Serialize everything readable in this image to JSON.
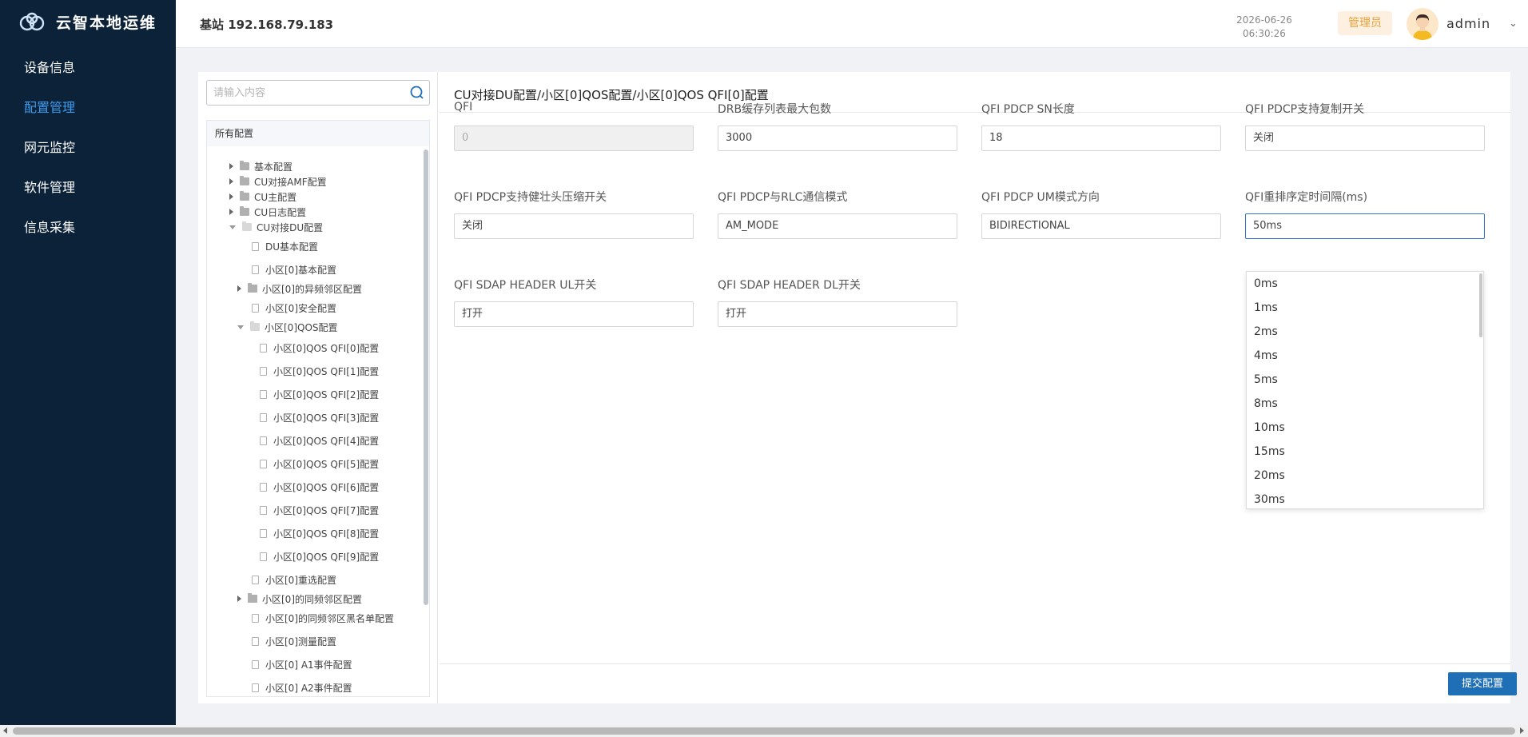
{
  "app": {
    "logo_text": "云智本地运维",
    "logo_icon": "cloud-logo-icon"
  },
  "sidebar": {
    "items": [
      {
        "label": "设备信息",
        "active": false
      },
      {
        "label": "配置管理",
        "active": true
      },
      {
        "label": "网元监控",
        "active": false
      },
      {
        "label": "软件管理",
        "active": false
      },
      {
        "label": "信息采集",
        "active": false
      }
    ],
    "active_color": "#3c9cf0",
    "bg_color": "#0c2238"
  },
  "header": {
    "station": "基站 192.168.79.183",
    "date": "2026-06-26",
    "time": "06:30:26",
    "role": "管理员",
    "username": "admin"
  },
  "tree": {
    "search_placeholder": "请输入内容",
    "root": "所有配置",
    "nodes": [
      {
        "label": "基本配置",
        "type": "folder",
        "expanded": false
      },
      {
        "label": "CU对接AMF配置",
        "type": "folder",
        "expanded": false
      },
      {
        "label": "CU主配置",
        "type": "folder",
        "expanded": false
      },
      {
        "label": "CU日志配置",
        "type": "folder",
        "expanded": false
      },
      {
        "label": "CU对接DU配置",
        "type": "folder",
        "expanded": true
      },
      {
        "label": "DU基本配置",
        "type": "file"
      },
      {
        "label": "小区[0]基本配置",
        "type": "file"
      },
      {
        "label": "小区[0]的异频邻区配置",
        "type": "folder",
        "expanded": false
      },
      {
        "label": "小区[0]安全配置",
        "type": "file"
      },
      {
        "label": "小区[0]QOS配置",
        "type": "folder",
        "expanded": true
      },
      {
        "label": "小区[0]QOS QFI[0]配置",
        "type": "file"
      },
      {
        "label": "小区[0]QOS QFI[1]配置",
        "type": "file"
      },
      {
        "label": "小区[0]QOS QFI[2]配置",
        "type": "file"
      },
      {
        "label": "小区[0]QOS QFI[3]配置",
        "type": "file"
      },
      {
        "label": "小区[0]QOS QFI[4]配置",
        "type": "file"
      },
      {
        "label": "小区[0]QOS QFI[5]配置",
        "type": "file"
      },
      {
        "label": "小区[0]QOS QFI[6]配置",
        "type": "file"
      },
      {
        "label": "小区[0]QOS QFI[7]配置",
        "type": "file"
      },
      {
        "label": "小区[0]QOS QFI[8]配置",
        "type": "file"
      },
      {
        "label": "小区[0]QOS QFI[9]配置",
        "type": "file"
      },
      {
        "label": "小区[0]重选配置",
        "type": "file"
      },
      {
        "label": "小区[0]的同频邻区配置",
        "type": "folder",
        "expanded": false
      },
      {
        "label": "小区[0]的同频邻区黑名单配置",
        "type": "file"
      },
      {
        "label": "小区[0]测量配置",
        "type": "file"
      },
      {
        "label": "小区[0] A1事件配置",
        "type": "file"
      },
      {
        "label": "小区[0] A2事件配置",
        "type": "file"
      }
    ]
  },
  "form": {
    "breadcrumb": "CU对接DU配置/小区[0]QOS配置/小区[0]QOS QFI[0]配置",
    "fields": [
      {
        "label": "QFI",
        "value": "0",
        "state": "disabled"
      },
      {
        "label": "DRB缓存列表最大包数",
        "value": "3000",
        "state": "normal"
      },
      {
        "label": "QFI PDCP SN长度",
        "value": "18",
        "state": "normal"
      },
      {
        "label": "QFI PDCP支持复制开关",
        "value": "关闭",
        "state": "normal"
      },
      {
        "label": "QFI PDCP支持健壮头压缩开关",
        "value": "关闭",
        "state": "normal"
      },
      {
        "label": "QFI PDCP与RLC通信模式",
        "value": "AM_MODE",
        "state": "normal"
      },
      {
        "label": "QFI PDCP UM模式方向",
        "value": "BIDIRECTIONAL",
        "state": "normal"
      },
      {
        "label": "QFI重排序定时间隔(ms)",
        "value": "50ms",
        "state": "focused"
      },
      {
        "label": "QFI SDAP HEADER UL开关",
        "value": "打开",
        "state": "normal"
      },
      {
        "label": "QFI SDAP HEADER DL开关",
        "value": "打开",
        "state": "normal"
      }
    ],
    "dropdown_options": [
      "0ms",
      "1ms",
      "2ms",
      "4ms",
      "5ms",
      "8ms",
      "10ms",
      "15ms",
      "20ms",
      "30ms"
    ],
    "submit_label": "提交配置",
    "focus_color": "#3273c9",
    "button_color": "#1e6fb5"
  }
}
